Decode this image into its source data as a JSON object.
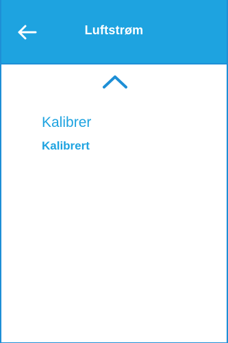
{
  "header": {
    "title": "Luftstrøm",
    "back_icon": "arrow-left-icon",
    "color": "#1ea3e0"
  },
  "scroll_icon": "chevron-up-icon",
  "menu": {
    "items": [
      {
        "label": "Kalibrer",
        "value": "Kalibrert"
      }
    ]
  },
  "accent_color": "#1ea3e0"
}
